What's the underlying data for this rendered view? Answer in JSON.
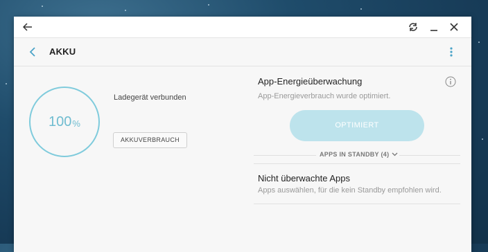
{
  "titlebar": {
    "back_icon": "arrow-left-icon",
    "rotate_icon": "rotate-icon",
    "minimize_icon": "minimize-icon",
    "close_icon": "close-icon"
  },
  "appbar": {
    "title": "AKKU"
  },
  "battery": {
    "level": "100",
    "unit": "%",
    "charger_status": "Ladegerät verbunden",
    "usage_button": "AKKUVERBRAUCH"
  },
  "power_monitor": {
    "title": "App-Energieüberwachung",
    "subtitle": "App-Energieverbrauch wurde optimiert.",
    "optimize_button": "OPTIMIERT",
    "standby_label": "APPS IN STANDBY (4)"
  },
  "unmonitored": {
    "title": "Nicht überwachte Apps",
    "subtitle": "Apps auswählen, für die kein Standby empfohlen wird."
  },
  "colors": {
    "accent": "#7fcbdc",
    "button_disabled": "#bde3ec"
  }
}
